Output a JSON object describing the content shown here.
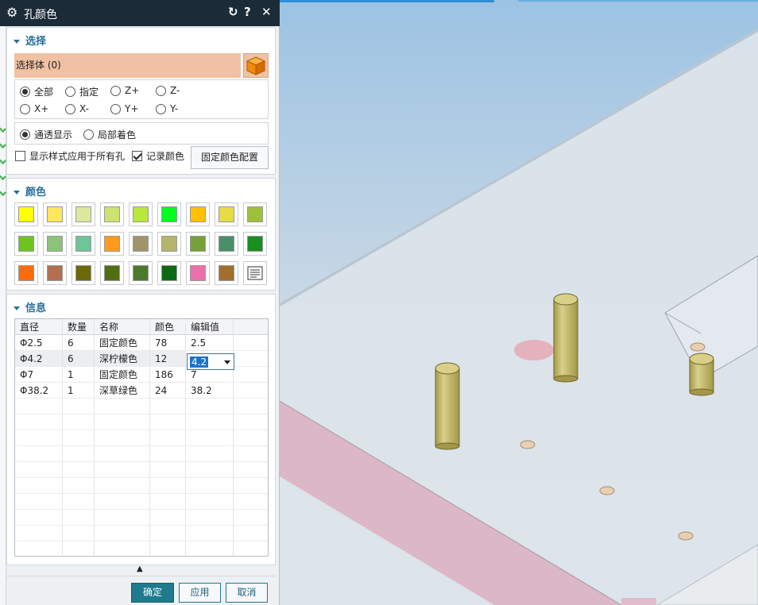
{
  "dialog": {
    "title": "孔颜色",
    "reset_symbol": "↻",
    "help_symbol": "?",
    "close_symbol": "✕"
  },
  "select_section": {
    "header": "选择",
    "select_body_label": "选择体 (0)",
    "direction_options": [
      "全部",
      "指定",
      "Z+",
      "Z-",
      "X+",
      "X-",
      "Y+",
      "Y-"
    ],
    "direction_selected": "全部",
    "display_options": [
      "通透显示",
      "局部着色"
    ],
    "display_selected": "通透显示",
    "apply_style_all_holes": {
      "label": "显示样式应用于所有孔",
      "checked": false
    },
    "record_color": {
      "label": "记录颜色",
      "checked": true
    },
    "fixed_color_config_button": "固定颜色配置"
  },
  "color_section": {
    "header": "颜色",
    "swatches": [
      "#ffff00",
      "#ffe65c",
      "#dde89c",
      "#cde370",
      "#b7e83a",
      "#00ff1e",
      "#ffc000",
      "#e6dc45",
      "#9ec03a",
      "#6ec41e",
      "#8ec27a",
      "#6fc49a",
      "#ff9a1e",
      "#a1946a",
      "#b5b66e",
      "#77a03a",
      "#4a8e6a",
      "#1a8e1e",
      "#ff6a0a",
      "#b36f50",
      "#6a6a0a",
      "#526e12",
      "#4b7a2a",
      "#0e6a12",
      "#ee6eaa",
      "#a06f2e"
    ],
    "more_colors_icon": "list-icon"
  },
  "info_section": {
    "header": "信息",
    "columns": [
      "直径",
      "数量",
      "名称",
      "颜色",
      "编辑值"
    ],
    "rows": [
      [
        "Φ2.5",
        "6",
        "固定颜色",
        "78",
        "2.5"
      ],
      [
        "Φ4.2",
        "6",
        "深柠檬色",
        "12",
        "4.2"
      ],
      [
        "Φ7",
        "1",
        "固定颜色",
        "186",
        "7"
      ],
      [
        "Φ38.2",
        "1",
        "深草绿色",
        "24",
        "38.2"
      ]
    ],
    "editing_value": "4.2"
  },
  "footer": {
    "collapse_symbol": "▲",
    "ok": "确定",
    "apply": "应用",
    "cancel": "取消"
  },
  "colors": {
    "titlebar": "#1c2b38",
    "accent": "#2a6f9a",
    "selection_highlight": "#f0c1a2",
    "primary_button": "#1f7a8c"
  }
}
